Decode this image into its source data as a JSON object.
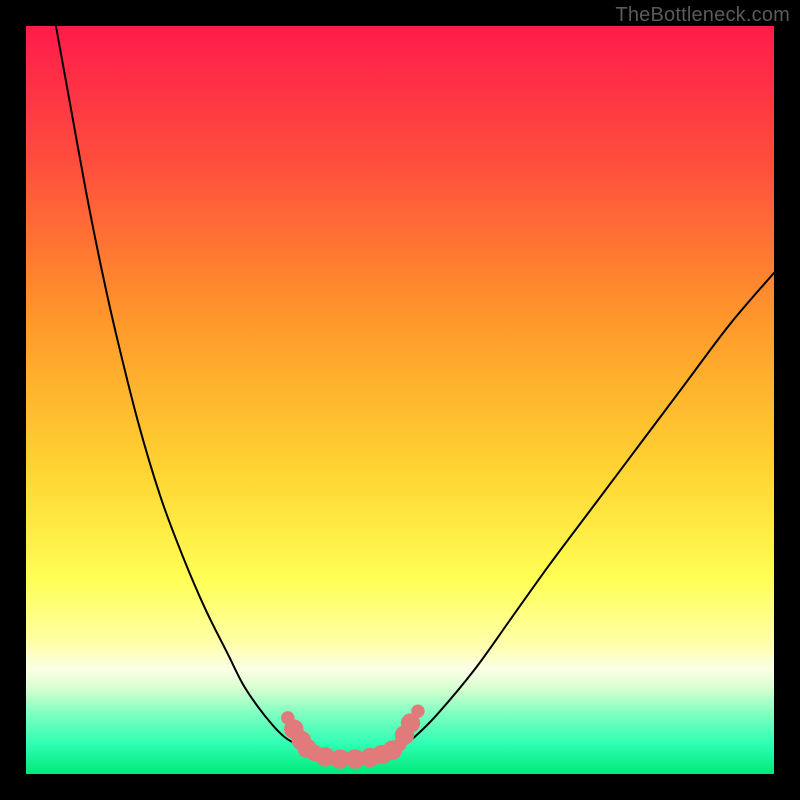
{
  "watermark": "TheBottleneck.com",
  "chart_data": {
    "type": "line",
    "title": "",
    "xlabel": "",
    "ylabel": "",
    "xlim": [
      0,
      100
    ],
    "ylim": [
      0,
      100
    ],
    "grid": false,
    "legend": false,
    "background_gradient": {
      "stops": [
        {
          "offset": 0.0,
          "color": "#ff1b4b"
        },
        {
          "offset": 0.18,
          "color": "#ff4d3d"
        },
        {
          "offset": 0.4,
          "color": "#ff9a2a"
        },
        {
          "offset": 0.6,
          "color": "#ffd633"
        },
        {
          "offset": 0.74,
          "color": "#ffff55"
        },
        {
          "offset": 0.825,
          "color": "#ffffa8"
        },
        {
          "offset": 0.86,
          "color": "#fbffe6"
        },
        {
          "offset": 0.885,
          "color": "#d8ffd0"
        },
        {
          "offset": 0.92,
          "color": "#7dffc0"
        },
        {
          "offset": 0.96,
          "color": "#2effb3"
        },
        {
          "offset": 1.0,
          "color": "#00e878"
        }
      ]
    },
    "series": [
      {
        "name": "left-branch",
        "x": [
          4,
          6,
          8,
          10,
          12,
          15,
          18,
          21,
          24,
          27,
          29,
          31,
          33,
          34.5,
          36,
          37,
          38
        ],
        "y": [
          100,
          89,
          78,
          68,
          59,
          47,
          37,
          29,
          22,
          16,
          12,
          9,
          6.5,
          5,
          4,
          3.2,
          2.8
        ]
      },
      {
        "name": "valley-floor",
        "x": [
          38,
          40,
          43,
          46,
          48,
          50
        ],
        "y": [
          2.8,
          2.2,
          2.0,
          2.2,
          2.8,
          3.5
        ]
      },
      {
        "name": "right-branch",
        "x": [
          50,
          52,
          55,
          60,
          65,
          70,
          76,
          82,
          88,
          94,
          100
        ],
        "y": [
          3.5,
          5,
          8,
          14,
          21,
          28,
          36,
          44,
          52,
          60,
          67
        ]
      }
    ],
    "markers": {
      "name": "scatter-dots",
      "color": "#e17a7a",
      "points": [
        {
          "x": 35.0,
          "y": 7.5,
          "r": 0.9
        },
        {
          "x": 35.8,
          "y": 6.0,
          "r": 1.3
        },
        {
          "x": 36.8,
          "y": 4.5,
          "r": 1.3
        },
        {
          "x": 37.6,
          "y": 3.4,
          "r": 1.3
        },
        {
          "x": 38.6,
          "y": 2.8,
          "r": 1.1
        },
        {
          "x": 40.0,
          "y": 2.3,
          "r": 1.3
        },
        {
          "x": 42.0,
          "y": 2.0,
          "r": 1.3
        },
        {
          "x": 44.0,
          "y": 2.0,
          "r": 1.3
        },
        {
          "x": 46.0,
          "y": 2.2,
          "r": 1.3
        },
        {
          "x": 47.6,
          "y": 2.6,
          "r": 1.3
        },
        {
          "x": 49.0,
          "y": 3.2,
          "r": 1.3
        },
        {
          "x": 50.0,
          "y": 4.0,
          "r": 0.9
        },
        {
          "x": 50.6,
          "y": 5.2,
          "r": 1.3
        },
        {
          "x": 51.4,
          "y": 6.8,
          "r": 1.3
        },
        {
          "x": 52.4,
          "y": 8.4,
          "r": 0.9
        }
      ]
    }
  }
}
